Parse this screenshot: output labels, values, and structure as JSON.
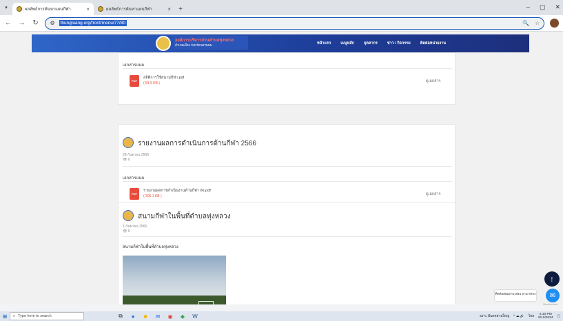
{
  "browser": {
    "tabs": [
      {
        "title": "ผลลัพธ์การค้นหาแผนกีฬา",
        "close": "×"
      },
      {
        "title": "ผลลัพธ์การค้นหาแผนกีฬา",
        "close": "×"
      }
    ],
    "new_tab": "+",
    "url": "thungluang.org/front/menu/77/80",
    "window_controls": [
      "–",
      "▢",
      "✕"
    ]
  },
  "site": {
    "name": "องค์การบริหารส่วนตำบลทุ่งหลวง",
    "subname": "อำเภอเมือง จังหวัดนครพนม",
    "nav": [
      "หน้าแรก",
      "เมนูหลัก",
      "บุคลากร",
      "ข่าว / กิจกรรม",
      "ติดต่อหน่วยงาน"
    ]
  },
  "card1": {
    "section_label": "เอกสารแนบ",
    "file": {
      "name": "สถิติการใช้สนามกีฬา.pdf",
      "size": "( 81.9 KB )",
      "icon": "PDF"
    },
    "view_label": "ดูเอกสาร"
  },
  "card2": {
    "title": "รายงานผลการดำเนินการด้านกีฬา 2566",
    "date": "28 กันยายน 2566",
    "views": "0",
    "section_label": "เอกสารแนบ",
    "file": {
      "name": "รายงานผลการดำเนินงานด้านกีฬา 66.pdf",
      "size": "( 306.1 KB )",
      "icon": "PDF"
    },
    "view_label": "ดูเอกสาร"
  },
  "card3": {
    "title": "สนามกีฬาในพื้นที่ตำบลทุ่งหลวง",
    "date": "1 กันยายน 2565",
    "views": "0",
    "caption": "สนามกีฬาในพื้นที่ตำบลทุ่งหลวง"
  },
  "widgets": {
    "chat_label": "ติดต่อสอบถาม สอบ ถาม หลวง",
    "chat_caption": "Questionnaire"
  },
  "taskbar": {
    "search_placeholder": "Type here to search",
    "weather": "33°C มีแดดส่วนใหญ่",
    "lang": "ไทย",
    "time": "2:10 PM",
    "date": "9/12/2024"
  },
  "colors": {
    "header_start": "#2f66c8",
    "header_end": "#1d2f7c",
    "pdf_red": "#e84b3c",
    "accent_blue": "#1e8ef0"
  }
}
